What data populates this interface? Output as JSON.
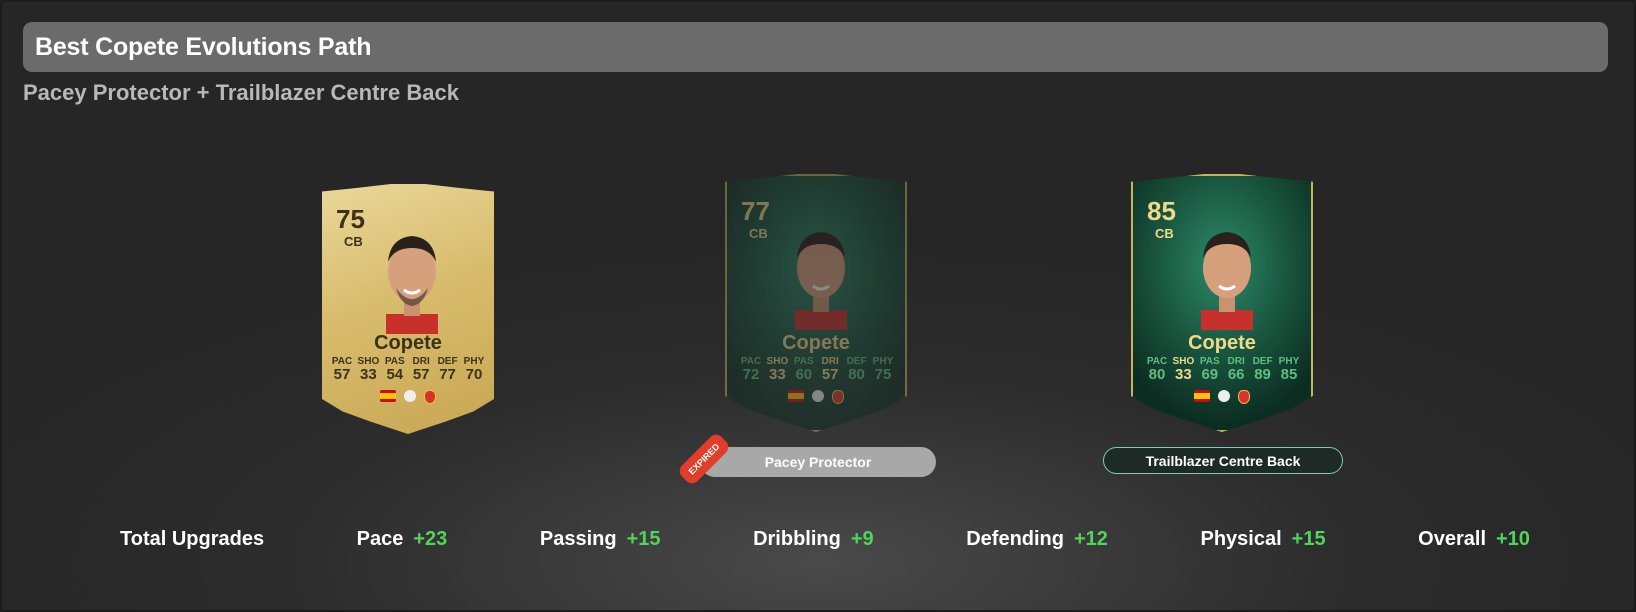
{
  "header": {
    "title": "Best Copete Evolutions Path",
    "subtitle": "Pacey Protector + Trailblazer Centre Back"
  },
  "cards": [
    {
      "rating": "75",
      "position": "CB",
      "name": "Copete",
      "labels": [
        "PAC",
        "SHO",
        "PAS",
        "DRI",
        "DEF",
        "PHY"
      ],
      "values": [
        "57",
        "33",
        "54",
        "57",
        "77",
        "70"
      ]
    },
    {
      "rating": "77",
      "position": "CB",
      "name": "Copete",
      "labels": [
        "PAC",
        "SHO",
        "PAS",
        "DRI",
        "DEF",
        "PHY"
      ],
      "values": [
        "72",
        "33",
        "60",
        "57",
        "80",
        "75"
      ]
    },
    {
      "rating": "85",
      "position": "CB",
      "name": "Copete",
      "labels": [
        "PAC",
        "SHO",
        "PAS",
        "DRI",
        "DEF",
        "PHY"
      ],
      "values": [
        "80",
        "33",
        "69",
        "66",
        "89",
        "85"
      ]
    }
  ],
  "evolutions": [
    {
      "label": "Pacey Protector",
      "tag": "EXPIRED"
    },
    {
      "label": "Trailblazer Centre Back"
    }
  ],
  "upgrades": {
    "title": "Total Upgrades",
    "items": [
      {
        "label": "Pace",
        "value": "+23"
      },
      {
        "label": "Passing",
        "value": "+15"
      },
      {
        "label": "Dribbling",
        "value": "+9"
      },
      {
        "label": "Defending",
        "value": "+12"
      },
      {
        "label": "Physical",
        "value": "+15"
      },
      {
        "label": "Overall",
        "value": "+10"
      }
    ]
  }
}
